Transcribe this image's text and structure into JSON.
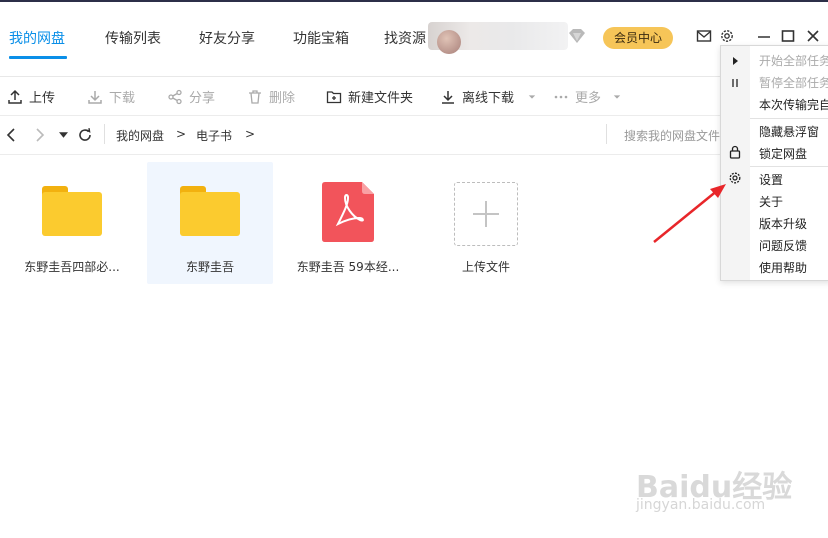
{
  "nav": {
    "tabs": [
      {
        "label": "我的网盘",
        "active": true
      },
      {
        "label": "传输列表",
        "active": false
      },
      {
        "label": "好友分享",
        "active": false
      },
      {
        "label": "功能宝箱",
        "active": false
      },
      {
        "label": "找资源",
        "active": false
      }
    ],
    "vip_label": "会员中心",
    "icons": [
      "mail-icon",
      "settings-icon",
      "minimize-icon",
      "maximize-icon",
      "close-icon"
    ]
  },
  "toolbar": {
    "buttons": [
      {
        "label": "上传",
        "icon": "upload-icon",
        "enabled": true
      },
      {
        "label": "下载",
        "icon": "download-icon",
        "enabled": false
      },
      {
        "label": "分享",
        "icon": "share-icon",
        "enabled": false
      },
      {
        "label": "删除",
        "icon": "delete-icon",
        "enabled": false
      },
      {
        "label": "新建文件夹",
        "icon": "new-folder-icon",
        "enabled": true
      },
      {
        "label": "离线下载",
        "icon": "offline-download-icon",
        "enabled": true
      },
      {
        "label": "更多",
        "icon": "more-icon",
        "enabled": false
      }
    ]
  },
  "address": {
    "breadcrumbs": [
      "我的网盘",
      "电子书"
    ],
    "separator": ">",
    "search_placeholder": "搜索我的网盘文件"
  },
  "files": [
    {
      "name": "东野圭吾四部必...",
      "type": "folder",
      "selected": false
    },
    {
      "name": "东野圭吾",
      "type": "folder",
      "selected": true
    },
    {
      "name": "东野圭吾 59本经...",
      "type": "pdf",
      "selected": false
    },
    {
      "name": "上传文件",
      "type": "upload",
      "selected": false
    }
  ],
  "settings_menu": {
    "group1": [
      {
        "label": "开始全部任务",
        "enabled": false,
        "icon": "play-icon"
      },
      {
        "label": "暂停全部任务",
        "enabled": false,
        "icon": "pause-icon"
      },
      {
        "label": "本次传输完自动关机",
        "enabled": true,
        "icon": ""
      }
    ],
    "group2": [
      {
        "label": "隐藏悬浮窗",
        "enabled": true,
        "icon": ""
      },
      {
        "label": "锁定网盘",
        "enabled": true,
        "icon": "lock-icon"
      }
    ],
    "group3": [
      {
        "label": "设置",
        "enabled": true,
        "icon": "gear-icon"
      },
      {
        "label": "关于",
        "enabled": true,
        "icon": ""
      },
      {
        "label": "版本升级",
        "enabled": true,
        "icon": ""
      },
      {
        "label": "问题反馈",
        "enabled": true,
        "icon": ""
      },
      {
        "label": "使用帮助",
        "enabled": true,
        "icon": ""
      }
    ]
  },
  "watermark": {
    "brand": "Baidu经验",
    "url": "jingyan.baidu.com"
  },
  "colors": {
    "accent": "#0a8fe8",
    "vip": "#f6c558",
    "folder": "#fbcb2f",
    "pdf": "#f2545b",
    "annotation_arrow": "#e8262a"
  }
}
